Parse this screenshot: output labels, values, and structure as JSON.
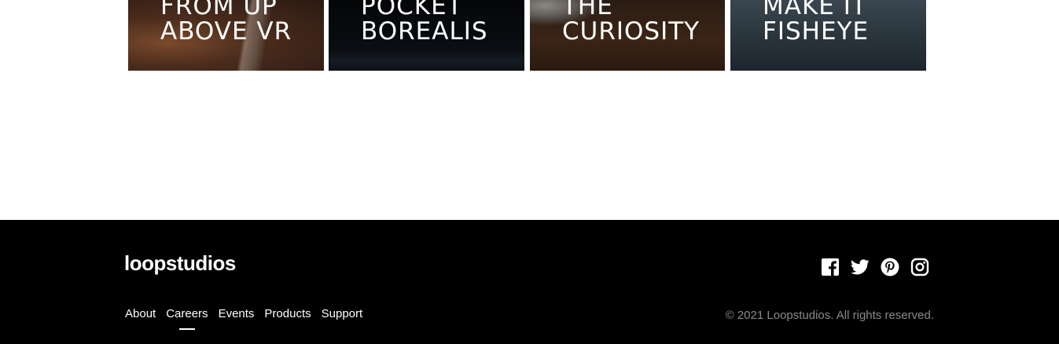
{
  "gallery": {
    "cards": [
      {
        "line1": "From up",
        "line2": "above VR"
      },
      {
        "line1": "Pocket",
        "line2": "borealis"
      },
      {
        "line1": "The",
        "line2": "curiosity"
      },
      {
        "line1": "Make it",
        "line2": "fisheye"
      }
    ]
  },
  "footer": {
    "logo": "loopstudios",
    "nav": [
      {
        "label": "About"
      },
      {
        "label": "Careers"
      },
      {
        "label": "Events"
      },
      {
        "label": "Products"
      },
      {
        "label": "Support"
      }
    ],
    "active_nav": "Careers",
    "social_icons": [
      "facebook-icon",
      "twitter-icon",
      "pinterest-icon",
      "instagram-icon"
    ],
    "copyright": "© 2021 Loopstudios. All rights reserved."
  },
  "colors": {
    "footer_bg": "#000000",
    "text_primary": "#ffffff",
    "text_muted": "#8a8a8a"
  }
}
